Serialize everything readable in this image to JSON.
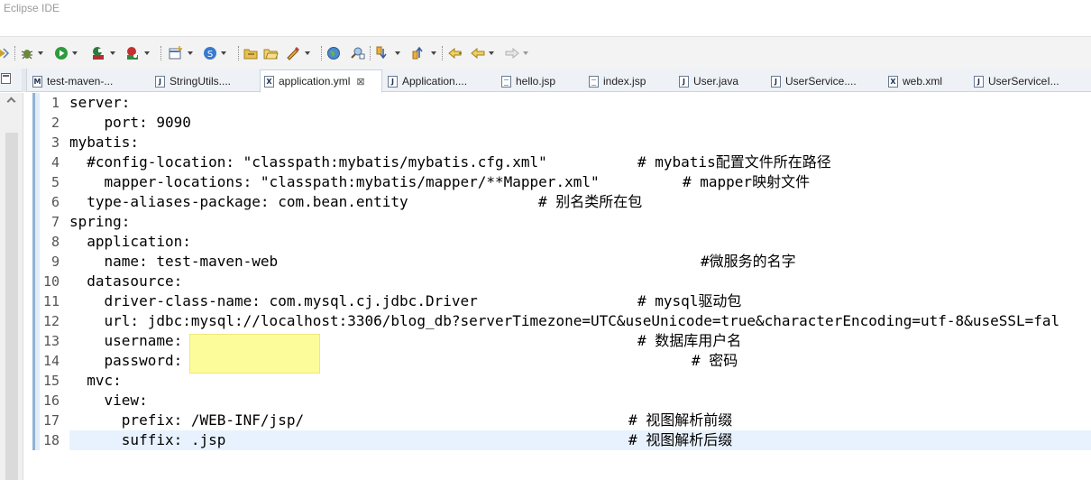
{
  "window": {
    "title": "Eclipse IDE"
  },
  "toolbar": {
    "items": [
      "skip-icon",
      "debug-icon",
      "run-icon",
      "run-config-icon",
      "coverage-icon",
      "new-icon",
      "new-java-icon",
      "open-icon",
      "open-folder-icon",
      "pencil-icon",
      "globe-icon",
      "search-icon",
      "next-annotation-icon",
      "prev-annotation-icon",
      "last-edit-icon",
      "back-icon",
      "forward-icon"
    ]
  },
  "tabs": [
    {
      "label": "test-maven-...",
      "icon": "M"
    },
    {
      "label": "StringUtils....",
      "icon": "J"
    },
    {
      "label": "application.yml",
      "icon": "X",
      "active": true,
      "close": "⊠"
    },
    {
      "label": "Application....",
      "icon": "J"
    },
    {
      "label": "hello.jsp",
      "icon": ""
    },
    {
      "label": "index.jsp",
      "icon": ""
    },
    {
      "label": "User.java",
      "icon": "J"
    },
    {
      "label": "UserService....",
      "icon": "J"
    },
    {
      "label": "web.xml",
      "icon": "X"
    },
    {
      "label": "UserServiceI...",
      "icon": "J"
    }
  ],
  "editor": {
    "current_line": 18,
    "lines": [
      {
        "num": "1",
        "text": "server:"
      },
      {
        "num": "2",
        "text": "    port: 9090"
      },
      {
        "num": "3",
        "text": "mybatis:"
      },
      {
        "num": "4",
        "text": "  #config-location: \"classpath:mybatis/mybatis.cfg.xml\"",
        "comment": "# mybatis配置文件所在路径"
      },
      {
        "num": "5",
        "text": "    mapper-locations: \"classpath:mybatis/mapper/**Mapper.xml\"",
        "comment": "# mapper映射文件"
      },
      {
        "num": "6",
        "text": "  type-aliases-package: com.bean.entity",
        "comment": "# 别名类所在包"
      },
      {
        "num": "7",
        "text": "spring:"
      },
      {
        "num": "8",
        "text": "  application:"
      },
      {
        "num": "9",
        "text": "    name: test-maven-web",
        "comment": "#微服务的名字"
      },
      {
        "num": "10",
        "text": "  datasource:"
      },
      {
        "num": "11",
        "text": "    driver-class-name: com.mysql.cj.jdbc.Driver",
        "comment": "# mysql驱动包"
      },
      {
        "num": "12",
        "text": "    url: jdbc:mysql://localhost:3306/blog_db?serverTimezone=UTC&useUnicode=true&characterEncoding=utf-8&useSSL=fal"
      },
      {
        "num": "13",
        "text": "    username:",
        "comment": "# 数据库用户名"
      },
      {
        "num": "14",
        "text": "    password:",
        "comment": "# 密码"
      },
      {
        "num": "15",
        "text": "  mvc:"
      },
      {
        "num": "16",
        "text": "    view:"
      },
      {
        "num": "17",
        "text": "      prefix: /WEB-INF/jsp/",
        "comment": "# 视图解析前缀"
      },
      {
        "num": "18",
        "text": "      suffix: .jsp",
        "comment": "# 视图解析后缀"
      }
    ]
  }
}
